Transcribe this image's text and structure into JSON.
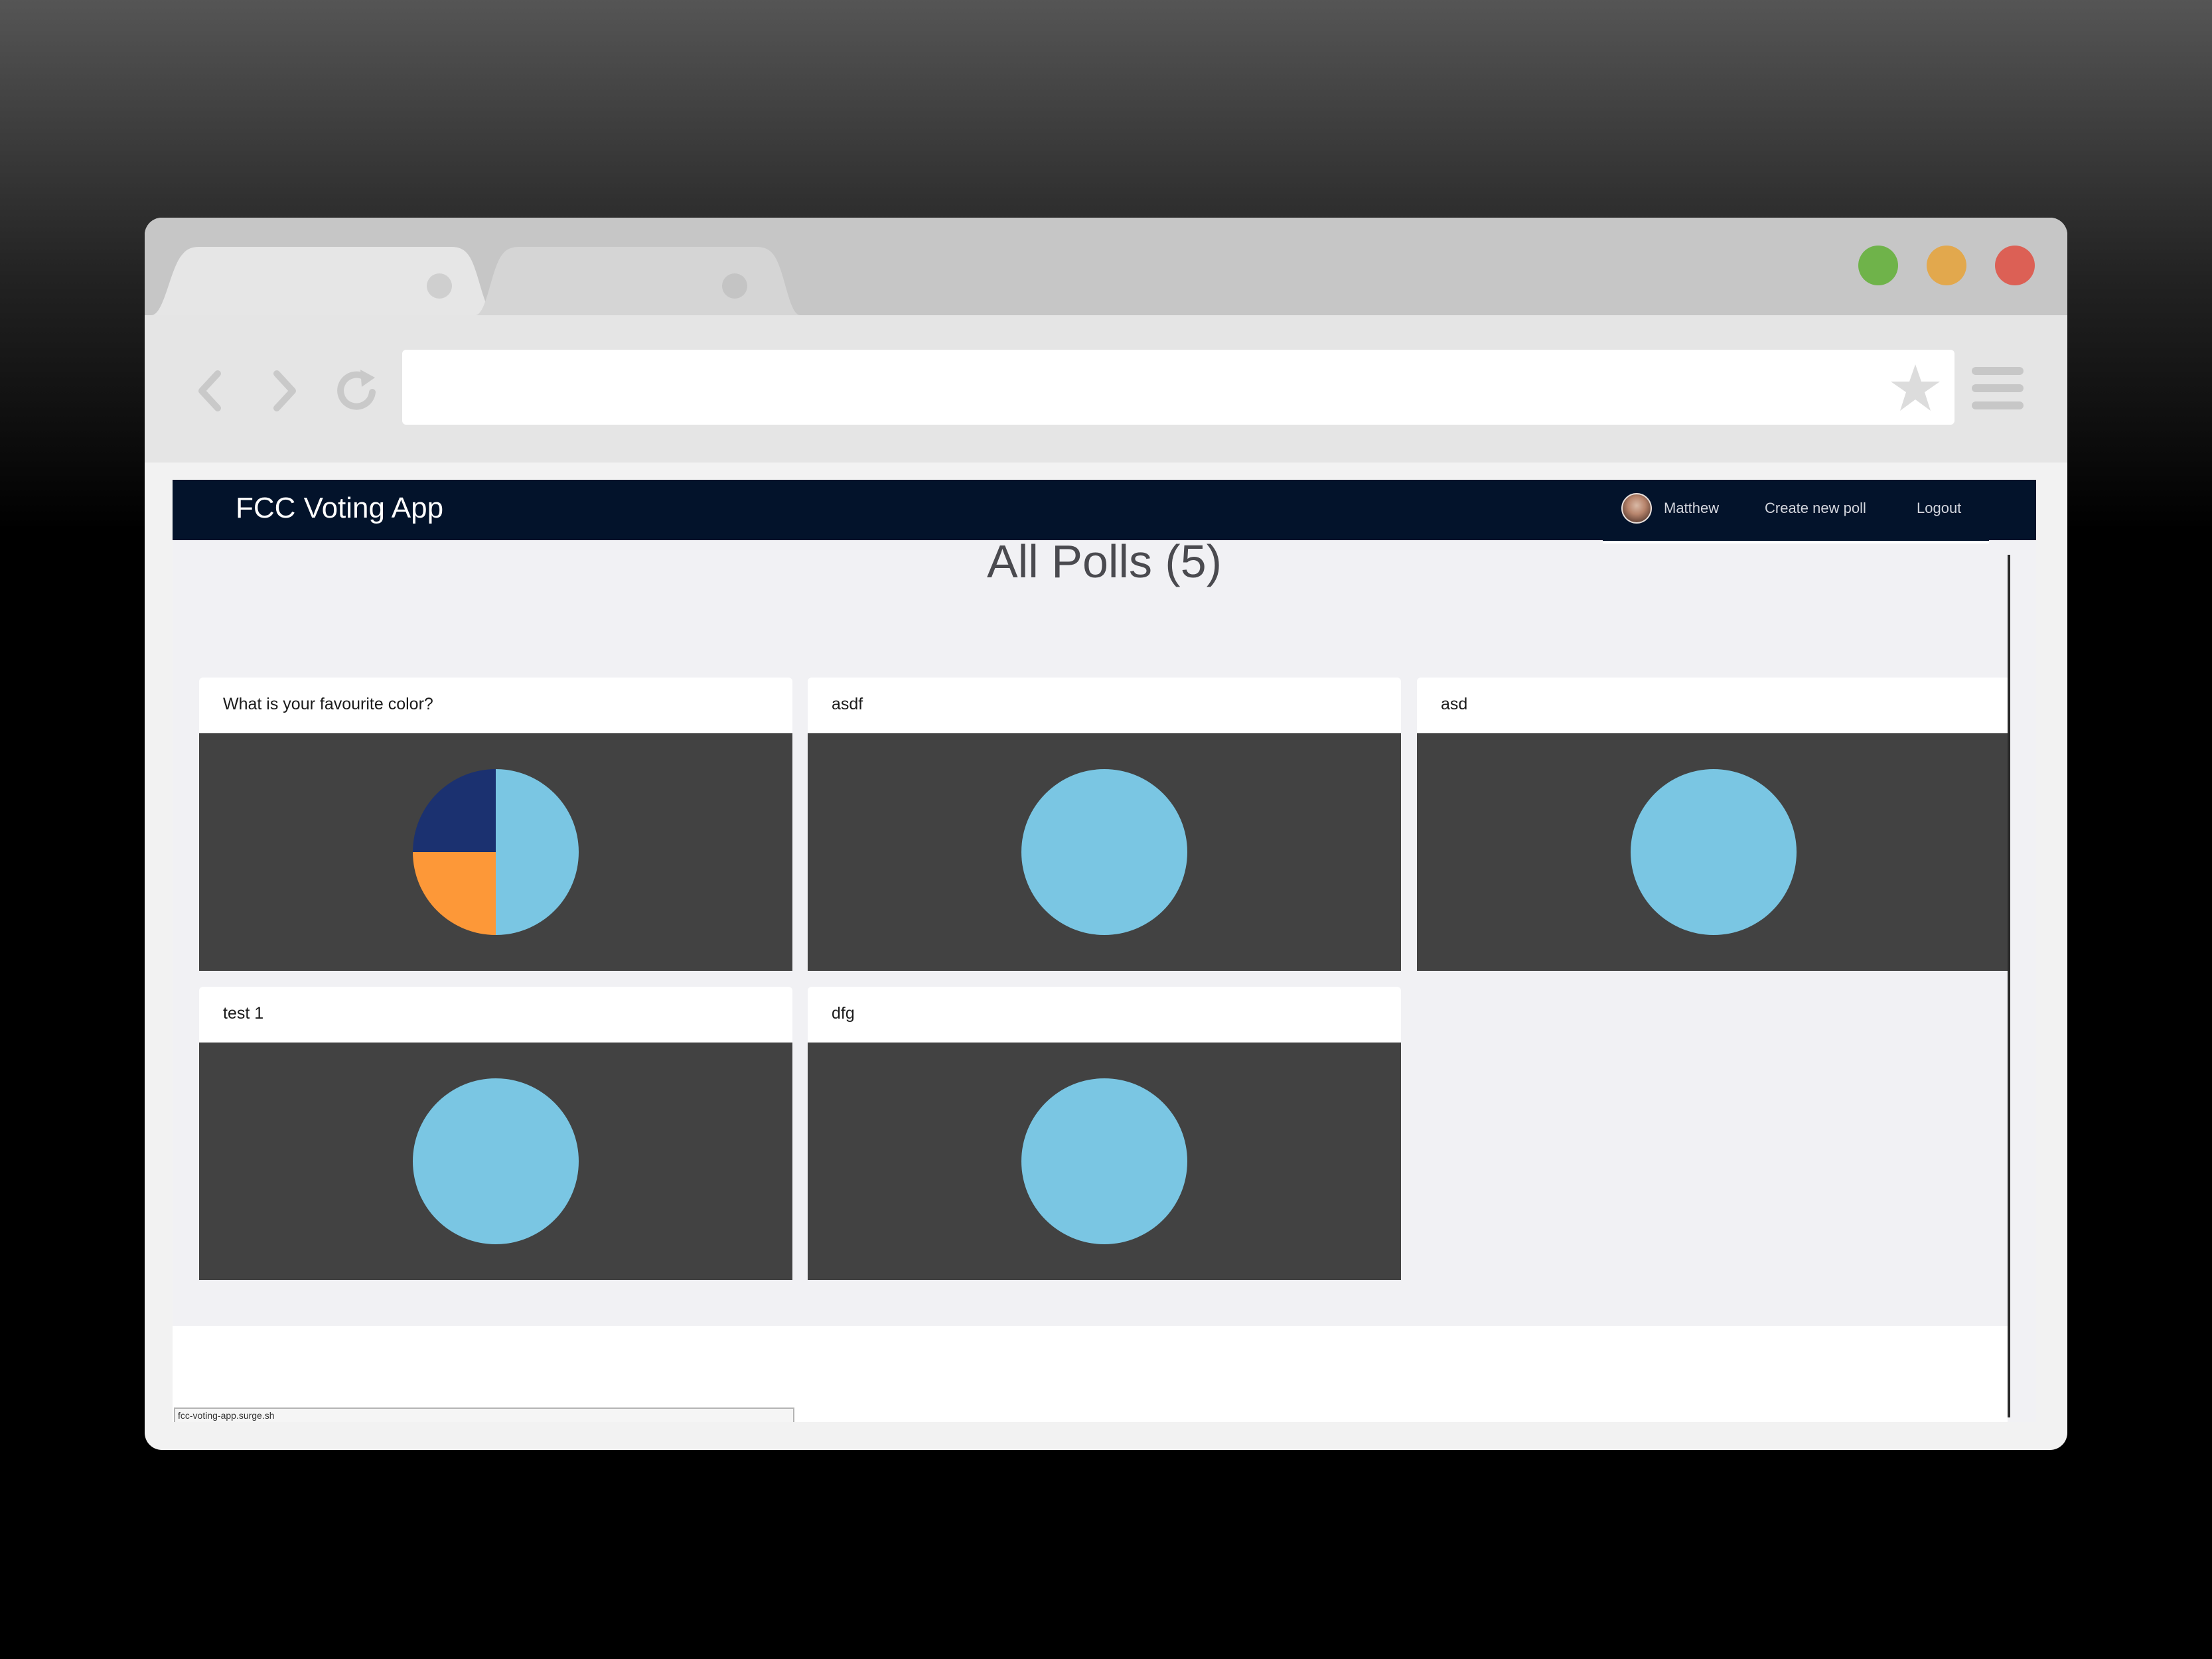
{
  "app": {
    "brand": "FCC Voting App",
    "nav": {
      "user": "Matthew",
      "create": "Create new poll",
      "logout": "Logout"
    },
    "heading": "All Polls (5)",
    "status_url": "fcc-voting-app.surge.sh"
  },
  "colors": {
    "navbar": "#03132b",
    "chart_background": "#424242",
    "slice_light_blue": "#7ac6e3",
    "slice_orange": "#fd9838",
    "slice_navy": "#1b3170"
  },
  "polls": [
    {
      "title": "What is your favourite color?"
    },
    {
      "title": "asdf"
    },
    {
      "title": "asd"
    },
    {
      "title": "test 1"
    },
    {
      "title": "dfg"
    }
  ],
  "chart_data": [
    {
      "type": "pie",
      "slices": [
        {
          "value": 2,
          "color": "#7ac6e3"
        },
        {
          "value": 1,
          "color": "#fd9838"
        },
        {
          "value": 1,
          "color": "#1b3170"
        }
      ]
    },
    {
      "type": "pie",
      "slices": [
        {
          "value": 1,
          "color": "#7ac6e3"
        }
      ]
    },
    {
      "type": "pie",
      "slices": [
        {
          "value": 1,
          "color": "#7ac6e3"
        }
      ]
    },
    {
      "type": "pie",
      "slices": [
        {
          "value": 1,
          "color": "#7ac6e3"
        }
      ]
    },
    {
      "type": "pie",
      "slices": [
        {
          "value": 1,
          "color": "#7ac6e3"
        }
      ]
    }
  ]
}
